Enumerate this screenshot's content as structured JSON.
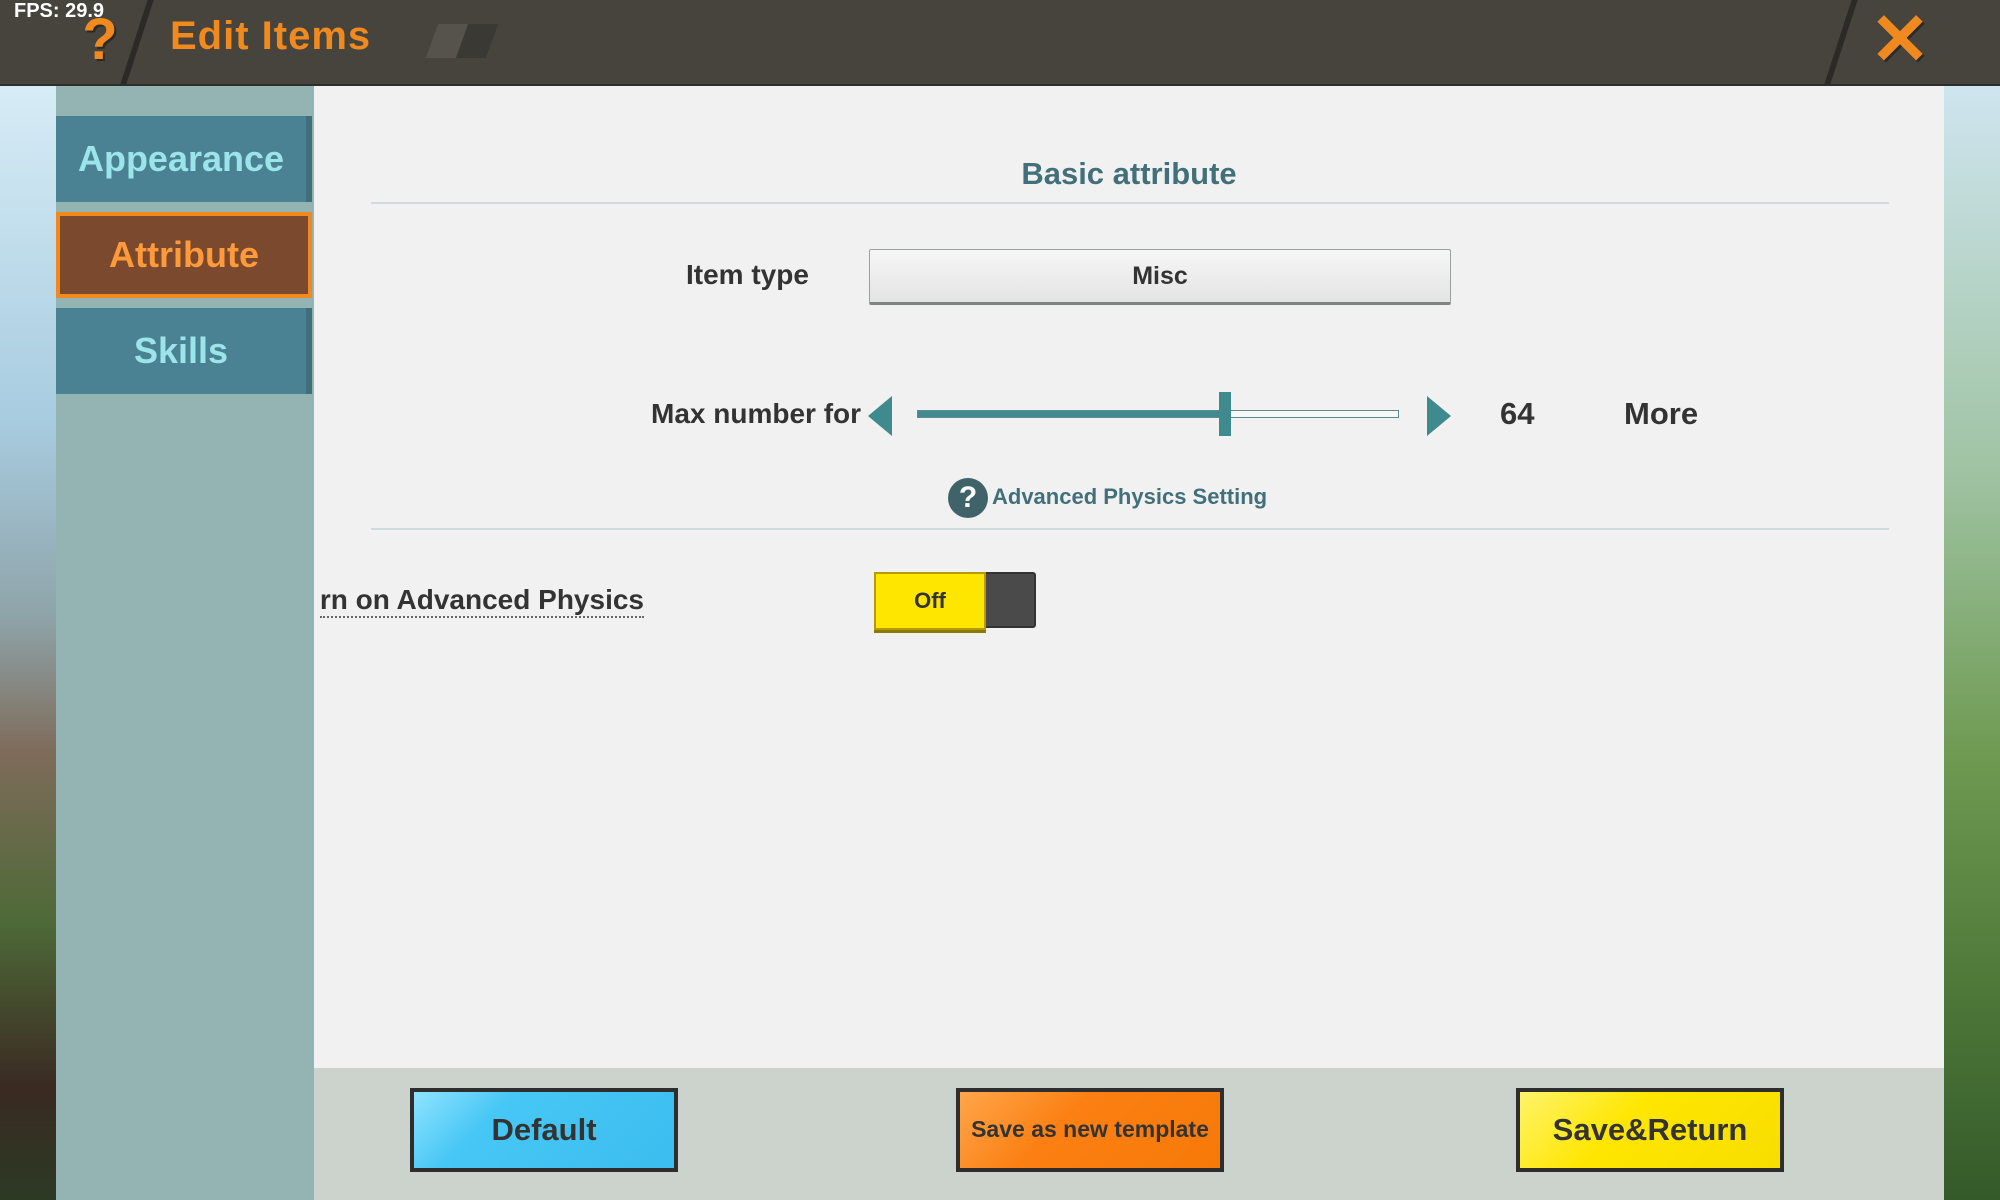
{
  "status": {
    "fps": "FPS: 29.9"
  },
  "header": {
    "help_icon_glyph": "?",
    "title": "Edit Items",
    "close_icon_glyph": "✕"
  },
  "sidebar": {
    "tabs": [
      {
        "label": "Appearance",
        "active": false
      },
      {
        "label": "Attribute",
        "active": true
      },
      {
        "label": "Skills",
        "active": false
      }
    ]
  },
  "main": {
    "section_title": "Basic attribute",
    "item_type": {
      "label": "Item type",
      "value": "Misc"
    },
    "max_number": {
      "label": "Max number for",
      "value": "64",
      "slider_fraction": 0.64,
      "more_label": "More"
    },
    "advanced": {
      "help_glyph": "?",
      "link_label": "Advanced Physics Setting",
      "toggle_label": "rn on Advanced Physics",
      "toggle_state": "Off"
    }
  },
  "footer": {
    "default_label": "Default",
    "template_label": "Save as new template",
    "save_label": "Save&Return"
  },
  "colors": {
    "accent_orange": "#f08a1f",
    "teal": "#3e8a8e",
    "toggle_yellow": "#ffe600"
  }
}
